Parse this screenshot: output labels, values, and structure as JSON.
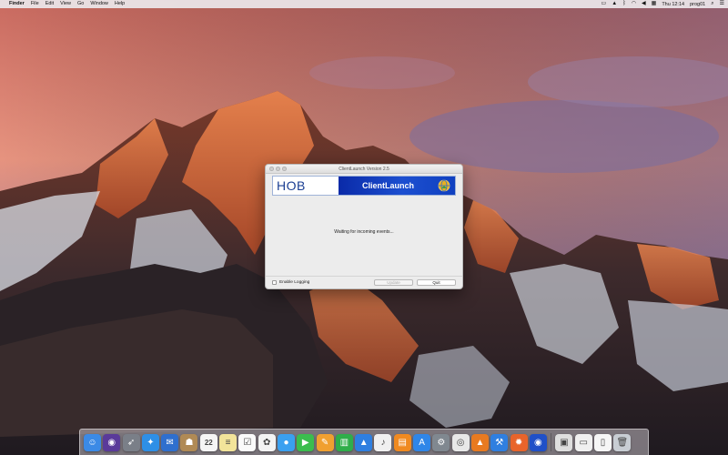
{
  "menubar": {
    "app_name": "Finder",
    "menus": [
      "File",
      "Edit",
      "View",
      "Go",
      "Window",
      "Help"
    ],
    "clock": "Thu 12:14",
    "user": "prog01"
  },
  "window": {
    "title": "ClientLaunch Version 2.5",
    "banner_logo": "HOB",
    "banner_brand": "ClientLaunch",
    "status_message": "Waiting for incoming events...",
    "enable_logging_label": "Enable Logging",
    "update_button": "Update",
    "quit_button": "Quit"
  },
  "colors": {
    "banner_blue": "#1c4fd0",
    "logo_blue": "#1b3f93"
  },
  "dock": {
    "apps": [
      {
        "name": "finder-icon",
        "glyph": "☺",
        "color": "#3b8ae6"
      },
      {
        "name": "siri-icon",
        "glyph": "◉",
        "color": "#5a3a9a"
      },
      {
        "name": "launchpad-icon",
        "glyph": "➶",
        "color": "#7a7f88"
      },
      {
        "name": "safari-icon",
        "glyph": "✦",
        "color": "#2e8fe6"
      },
      {
        "name": "mail-icon",
        "glyph": "✉",
        "color": "#2f6fce"
      },
      {
        "name": "contacts-icon",
        "glyph": "☗",
        "color": "#b08a55"
      },
      {
        "name": "calendar-icon",
        "glyph": "22",
        "color": "#f5f5f5"
      },
      {
        "name": "notes-icon",
        "glyph": "≡",
        "color": "#f2e49a"
      },
      {
        "name": "reminders-icon",
        "glyph": "☑",
        "color": "#fafafa"
      },
      {
        "name": "photos-icon",
        "glyph": "✿",
        "color": "#f3f3f3"
      },
      {
        "name": "messages-icon",
        "glyph": "●",
        "color": "#3aa0f0"
      },
      {
        "name": "facetime-icon",
        "glyph": "▶",
        "color": "#3bbd4e"
      },
      {
        "name": "pages-icon",
        "glyph": "✎",
        "color": "#f0a030"
      },
      {
        "name": "numbers-icon",
        "glyph": "▥",
        "color": "#2fae4a"
      },
      {
        "name": "keynote-icon",
        "glyph": "▲",
        "color": "#2f7fe0"
      },
      {
        "name": "itunes-icon",
        "glyph": "♪",
        "color": "#f0f0f0"
      },
      {
        "name": "ibooks-icon",
        "glyph": "▤",
        "color": "#f08a20"
      },
      {
        "name": "app-store-icon",
        "glyph": "A",
        "color": "#2f86e8"
      },
      {
        "name": "system-preferences-icon",
        "glyph": "⚙",
        "color": "#808890"
      },
      {
        "name": "chrome-icon",
        "glyph": "◎",
        "color": "#e8e8e8"
      },
      {
        "name": "vlc-icon",
        "glyph": "▲",
        "color": "#e87a20"
      },
      {
        "name": "xcode-icon",
        "glyph": "⚒",
        "color": "#2f7fe0"
      },
      {
        "name": "firefox-icon",
        "glyph": "✹",
        "color": "#e8642a"
      },
      {
        "name": "clientlaunch-icon",
        "glyph": "◉",
        "color": "#2050c8"
      }
    ],
    "right_items": [
      {
        "name": "preview-icon",
        "glyph": "▣",
        "color": "#dedede"
      },
      {
        "name": "downloads-stack-icon",
        "glyph": "▭",
        "color": "#f0f0f0"
      },
      {
        "name": "documents-stack-icon",
        "glyph": "▯",
        "color": "#f6f6f6"
      },
      {
        "name": "trash-icon",
        "glyph": "🗑",
        "color": "#c8cdd3"
      }
    ]
  }
}
